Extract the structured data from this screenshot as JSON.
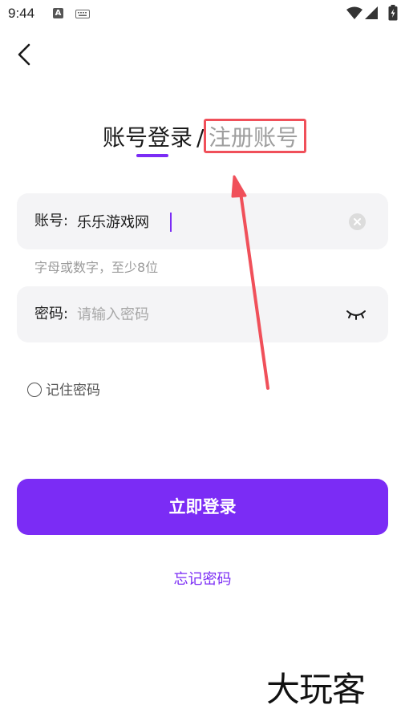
{
  "status_bar": {
    "time": "9:44",
    "a_icon": "A",
    "icons": [
      "wifi-icon",
      "signal-icon",
      "battery-icon"
    ]
  },
  "nav": {
    "back_icon": "chevron-left-icon"
  },
  "tabs": {
    "login": "账号登录",
    "separator": "/",
    "register": "注册账号",
    "active": "login"
  },
  "account_field": {
    "label": "账号:",
    "value": "乐乐游戏网",
    "clear_icon": "clear-circle-icon"
  },
  "account_hint": "字母或数字，至少8位",
  "password_field": {
    "label": "密码:",
    "placeholder": "请输入密码",
    "toggle_icon": "eye-closed-icon"
  },
  "remember": {
    "label": "记住密码",
    "checked": false
  },
  "login_button": "立即登录",
  "forgot_link": "忘记密码",
  "watermark": "大玩客",
  "colors": {
    "accent": "#7b2cf5",
    "annotation": "#f0505a"
  }
}
